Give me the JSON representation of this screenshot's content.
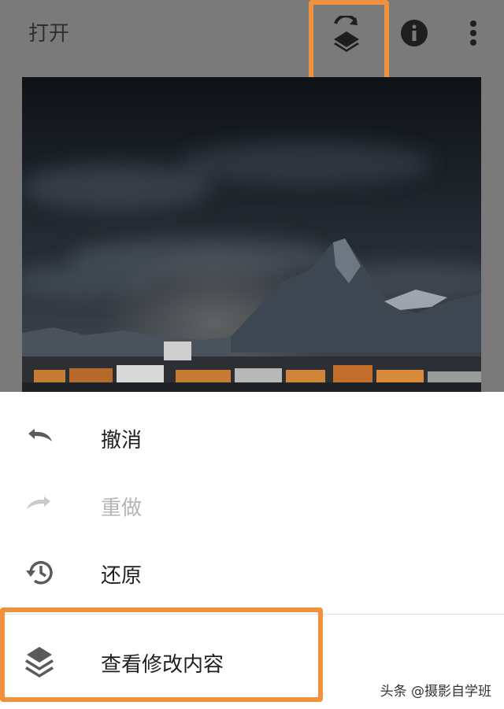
{
  "toolbar": {
    "open_label": "打开",
    "icons": [
      "layers-undo-icon",
      "info-icon",
      "more-vert-icon"
    ]
  },
  "menu": {
    "items": [
      {
        "label": "撤消",
        "icon": "undo-icon",
        "enabled": true
      },
      {
        "label": "重做",
        "icon": "redo-icon",
        "enabled": false
      },
      {
        "label": "还原",
        "icon": "history-icon",
        "enabled": true
      },
      {
        "label": "查看修改内容",
        "icon": "layers-icon",
        "enabled": true
      }
    ]
  },
  "watermark": "头条 @摄影自学班",
  "colors": {
    "highlight": "#f0913e",
    "toolbar_bg": "#7a7a7a",
    "sheet_bg": "#ffffff"
  }
}
